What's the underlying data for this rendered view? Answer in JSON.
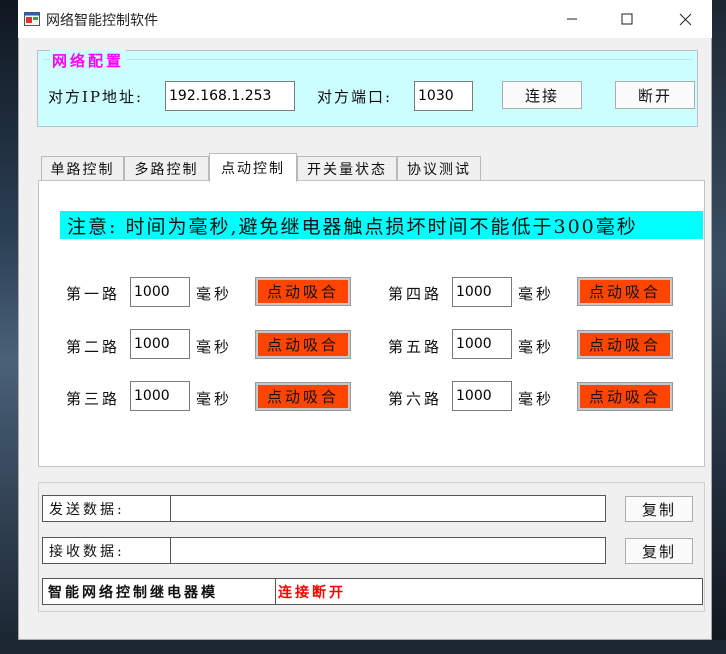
{
  "window": {
    "title": "网络智能控制软件",
    "controls": {
      "minimize": "—",
      "maximize": "☐",
      "close": "✕"
    }
  },
  "config": {
    "legend": "网络配置",
    "ip_label": "对方IP地址:",
    "ip_value": "192.168.1.253",
    "port_label": "对方端口:",
    "port_value": "1030",
    "connect_label": "连接",
    "disconnect_label": "断开"
  },
  "tabs": [
    {
      "label": "单路控制",
      "active": false
    },
    {
      "label": "多路控制",
      "active": false
    },
    {
      "label": "点动控制",
      "active": true
    },
    {
      "label": "开关量状态",
      "active": false
    },
    {
      "label": "协议测试",
      "active": false
    }
  ],
  "jog_panel": {
    "notice": "注意: 时间为毫秒,避免继电器触点损坏时间不能低于300毫秒",
    "unit": "毫秒",
    "button_label": "点动吸合",
    "channels": [
      {
        "label": "第一路",
        "value": "1000"
      },
      {
        "label": "第二路",
        "value": "1000"
      },
      {
        "label": "第三路",
        "value": "1000"
      },
      {
        "label": "第四路",
        "value": "1000"
      },
      {
        "label": "第五路",
        "value": "1000"
      },
      {
        "label": "第六路",
        "value": "1000"
      }
    ]
  },
  "data": {
    "send_label": "发送数据:",
    "send_value": "",
    "receive_label": "接收数据:",
    "receive_value": "",
    "copy_label": "复制"
  },
  "status": {
    "left": "智能网络控制继电器模",
    "right": "连接断开"
  },
  "colors": {
    "config_bg": "#ccffff",
    "legend": "#ff00ff",
    "notice_bg": "#00ffff",
    "jog_button": "#ff4500",
    "status_alert": "#ff0000"
  }
}
